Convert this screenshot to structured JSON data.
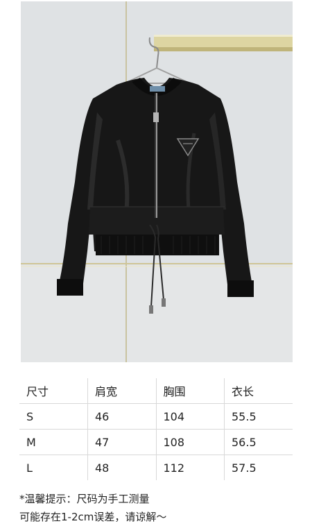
{
  "product_image": {
    "alt_subject": "black bomber jacket on hanger",
    "colors": {
      "background": "#dcdfe1",
      "jacket": "#151515",
      "shelf": "#d8cf9a"
    }
  },
  "size_table": {
    "headers": [
      "尺寸",
      "肩宽",
      "胸围",
      "衣长"
    ],
    "rows": [
      [
        "S",
        "46",
        "104",
        "55.5"
      ],
      [
        "M",
        "47",
        "108",
        "56.5"
      ],
      [
        "L",
        "48",
        "112",
        "57.5"
      ]
    ]
  },
  "note": {
    "line1": "*温馨提示：尺码为手工测量",
    "line2": "可能存在1-2cm误差，请谅解～"
  }
}
